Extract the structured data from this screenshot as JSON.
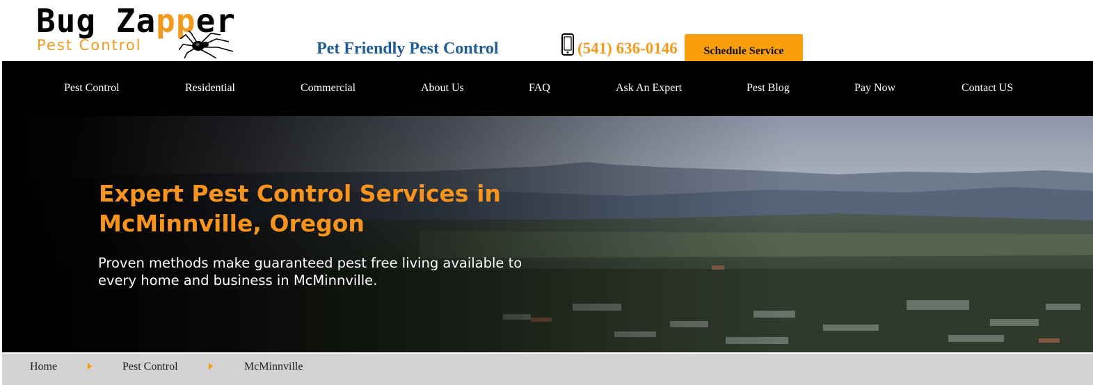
{
  "header": {
    "logo": {
      "word1": "Bug Za",
      "accent": "pp",
      "word2": "er",
      "subtitle": "Pest Control"
    },
    "tagline": "Pet Friendly Pest Control",
    "phone_icon": "mobile-phone-icon",
    "phone": "(541) 636-0146",
    "schedule_label": "Schedule Service"
  },
  "nav": {
    "items": [
      {
        "label": "Pest Control"
      },
      {
        "label": "Residential"
      },
      {
        "label": "Commercial"
      },
      {
        "label": "About Us"
      },
      {
        "label": "FAQ"
      },
      {
        "label": "Ask An Expert"
      },
      {
        "label": "Pest Blog"
      },
      {
        "label": "Pay Now"
      },
      {
        "label": "Contact US"
      }
    ]
  },
  "hero": {
    "title": "Expert Pest Control Services in McMinnville, Oregon",
    "subtitle": "Proven methods make guaranteed pest free living available to every home and business in McMinnville."
  },
  "breadcrumb": {
    "items": [
      "Home",
      "Pest Control",
      "McMinnville"
    ],
    "separator_icon": "caret-right-icon"
  },
  "colors": {
    "accent": "#f99e0c",
    "tagline": "#1f5b94",
    "nav_bg": "#000000",
    "breadcrumb_bg": "#d2d2d2"
  }
}
